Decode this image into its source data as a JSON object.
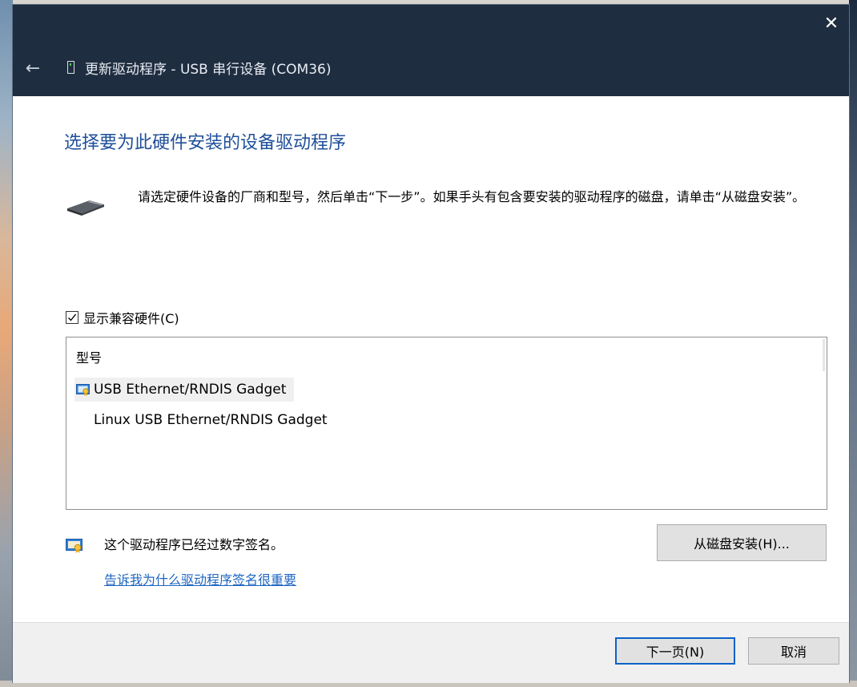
{
  "titlebar": {
    "back": "←",
    "close": "✕",
    "title": "更新驱动程序 - USB 串行设备 (COM36)"
  },
  "heading": "选择要为此硬件安装的设备驱动程序",
  "description": "请选定硬件设备的厂商和型号，然后单击“下一步”。如果手头有包含要安装的驱动程序的磁盘，请单击“从磁盘安装”。",
  "compat_checkbox": {
    "label": "显示兼容硬件(C)",
    "checked": true
  },
  "model_list": {
    "header": "型号",
    "items": [
      {
        "label": "USB Ethernet/RNDIS Gadget",
        "selected": true,
        "icon": "signed-certificate-icon"
      },
      {
        "label": "Linux USB Ethernet/RNDIS Gadget",
        "selected": false,
        "icon": ""
      }
    ]
  },
  "signature": {
    "text": "这个驱动程序已经过数字签名。",
    "link": "告诉我为什么驱动程序签名很重要",
    "icon": "signed-certificate-icon"
  },
  "buttons": {
    "have_disk": "从磁盘安装(H)...",
    "next": "下一页(N)",
    "cancel": "取消"
  },
  "colors": {
    "titlebar_bg": "#1f2d40",
    "heading": "#1f4f9a",
    "link": "#1f66c1",
    "default_button_border": "#0a62c8"
  }
}
